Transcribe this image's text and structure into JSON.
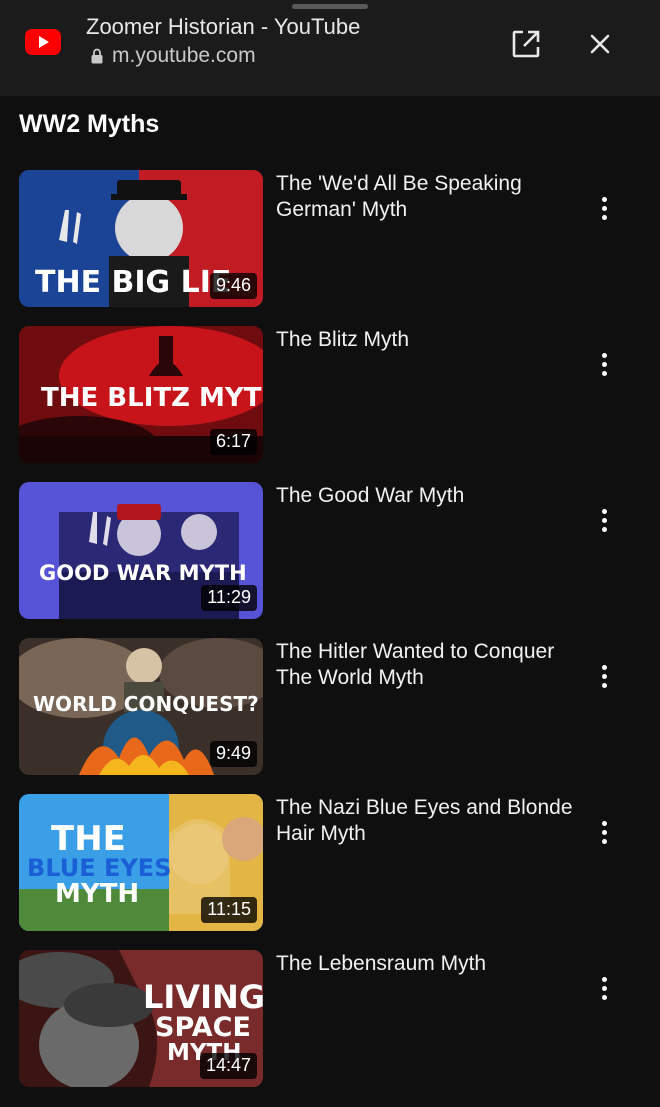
{
  "browser": {
    "title": "Zoomer Historian - YouTube",
    "url": "m.youtube.com",
    "icons": {
      "logo": "youtube-logo-icon",
      "lock": "lock-icon",
      "open": "open-external-icon",
      "close": "close-icon"
    }
  },
  "playlist": {
    "title": "WW2 Myths",
    "videos": [
      {
        "title": "The 'We'd All Be Speaking German' Myth",
        "duration": "9:46",
        "thumb_text": [
          "THE BIG LIE"
        ],
        "thumb_colors": [
          "#1b3f91",
          "#c31a22"
        ]
      },
      {
        "title": "The Blitz Myth",
        "duration": "6:17",
        "thumb_text": [
          "THE BLITZ MYTH"
        ],
        "thumb_colors": [
          "#7d0f12",
          "#e21a1f"
        ]
      },
      {
        "title": "The Good War Myth",
        "duration": "11:29",
        "thumb_text": [
          "GOOD WAR MYTH"
        ],
        "thumb_colors": [
          "#5a56d8",
          "#2e2b7a"
        ]
      },
      {
        "title": "The Hitler Wanted to Conquer The World Myth",
        "duration": "9:49",
        "thumb_text": [
          "WORLD CONQUEST?"
        ],
        "thumb_colors": [
          "#6a5a4e",
          "#e66b1a"
        ]
      },
      {
        "title": "The Nazi Blue Eyes and Blonde Hair Myth",
        "duration": "11:15",
        "thumb_text": [
          "THE",
          "BLUE EYES",
          "MYTH"
        ],
        "thumb_colors": [
          "#3aa0e8",
          "#e8b840"
        ]
      },
      {
        "title": "The Lebensraum Myth",
        "duration": "14:47",
        "thumb_text": [
          "LIVING",
          "SPACE",
          "MYTH"
        ],
        "thumb_colors": [
          "#4a1d1d",
          "#9a3a3a"
        ]
      }
    ]
  }
}
